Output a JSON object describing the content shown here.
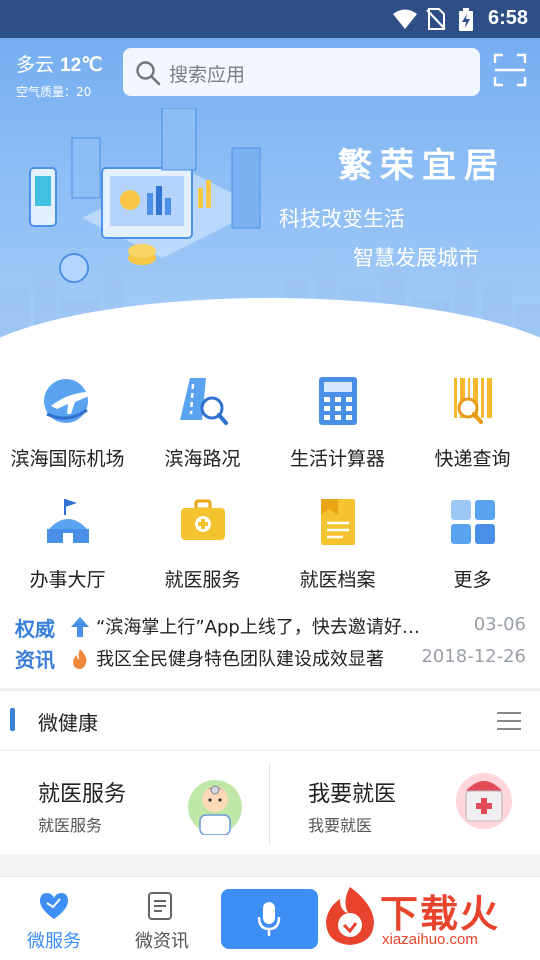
{
  "status_bar": {
    "time": "6:58"
  },
  "header": {
    "weather": {
      "condition": "多云",
      "temperature": "12℃",
      "air_quality": "空气质量：20"
    },
    "search": {
      "placeholder": "搜索应用"
    }
  },
  "banner": {
    "slogan_main": "繁荣宜居",
    "slogan_line1": "科技改变生活",
    "slogan_line2": "智慧发展城市",
    "page_count": 3,
    "active_page": 2
  },
  "services": [
    {
      "label": "滨海国际机场",
      "icon": "airplane-icon"
    },
    {
      "label": "滨海路况",
      "icon": "road-search-icon"
    },
    {
      "label": "生活计算器",
      "icon": "calculator-icon"
    },
    {
      "label": "快递查询",
      "icon": "barcode-search-icon"
    },
    {
      "label": "办事大厅",
      "icon": "government-hall-icon"
    },
    {
      "label": "就医服务",
      "icon": "medical-kit-icon"
    },
    {
      "label": "就医档案",
      "icon": "medical-record-icon"
    },
    {
      "label": "更多",
      "icon": "grid-more-icon"
    }
  ],
  "news": {
    "tag_line1": "权威",
    "tag_line2": "资讯",
    "items": [
      {
        "title": "“滨海掌上行”App上线了，快去邀请好友一起使用吧",
        "date": "03-06",
        "icon": "arrow-up-icon"
      },
      {
        "title": "我区全民健身特色团队建设成效显著",
        "date": "2018-12-26",
        "icon": "flame-icon"
      }
    ]
  },
  "health": {
    "section_title": "微健康",
    "cards": [
      {
        "title": "就医服务",
        "subtitle": "就医服务",
        "icon": "doctor-icon"
      },
      {
        "title": "我要就医",
        "subtitle": "我要就医",
        "icon": "first-aid-kit-icon"
      }
    ]
  },
  "tabbar": {
    "tabs": [
      {
        "label": "微服务",
        "icon": "heart-icon",
        "active": true
      },
      {
        "label": "微资讯",
        "icon": "document-icon",
        "active": false
      }
    ],
    "voice_icon": "microphone-icon"
  },
  "watermark": {
    "brand": "下载火",
    "url": "xiazaihuo.com"
  },
  "colors": {
    "accent": "#3a7fd8",
    "status_bar": "#2e4f86",
    "voice_button": "#3d8ef5",
    "watermark": "#e8432d"
  }
}
